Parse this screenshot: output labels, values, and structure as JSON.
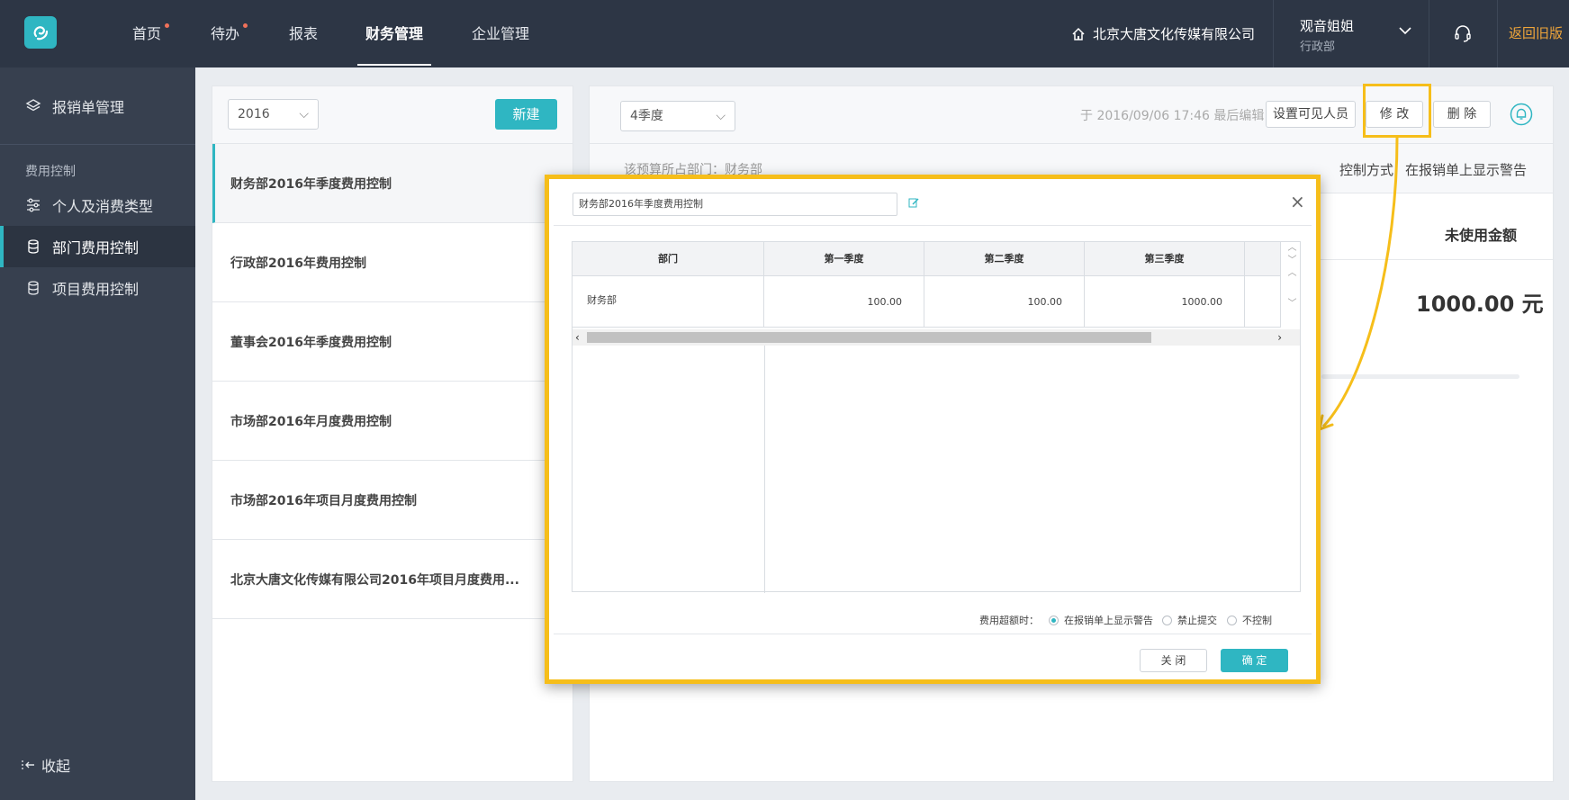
{
  "nav": {
    "items": [
      "首页",
      "待办",
      "报表",
      "财务管理",
      "企业管理"
    ],
    "active": "财务管理",
    "company": "北京大唐文化传媒有限公司",
    "user_name": "观音姐姐",
    "user_dept": "行政部",
    "return_old": "返回旧版"
  },
  "sidebar": {
    "top_item": "报销单管理",
    "group_label": "费用控制",
    "items": [
      "个人及消费类型",
      "部门费用控制",
      "项目费用控制"
    ],
    "active": "部门费用控制",
    "collapse": "收起"
  },
  "list": {
    "year": "2016",
    "new_button": "新建",
    "items": [
      "财务部2016年季度费用控制",
      "行政部2016年费用控制",
      "董事会2016年季度费用控制",
      "市场部2016年月度费用控制",
      "市场部2016年项目月度费用控制",
      "北京大唐文化传媒有限公司2016年项目月度费用..."
    ]
  },
  "main": {
    "quarter": "4季度",
    "edited": "于 2016/09/06 17:46 最后编辑",
    "buttons": {
      "visible": "设置可见人员",
      "modify": "修 改",
      "delete": "删 除"
    },
    "subhead_faded": "该预算所占部门：财务部",
    "control_mode": "控制方式",
    "control_value": "在报销单上显示警告",
    "unused_label": "未使用金额",
    "unused_amount": "1000.00 元"
  },
  "modal": {
    "title": "财务部2016年季度费用控制",
    "columns": [
      "部门",
      "第一季度",
      "第二季度",
      "第三季度"
    ],
    "rows": [
      {
        "dept": "财务部",
        "values": [
          "100.00",
          "100.00",
          "1000.00"
        ]
      }
    ],
    "over_label": "费用超额时：",
    "options": [
      "在报销单上显示警告",
      "禁止提交",
      "不控制"
    ],
    "selected_option": "在报销单上显示警告",
    "close": "关 闭",
    "ok": "确 定"
  },
  "colors": {
    "accent": "#2fb6c2",
    "highlight": "#f6be1a",
    "topbar": "#2d3645",
    "sidebar": "#37404f"
  }
}
